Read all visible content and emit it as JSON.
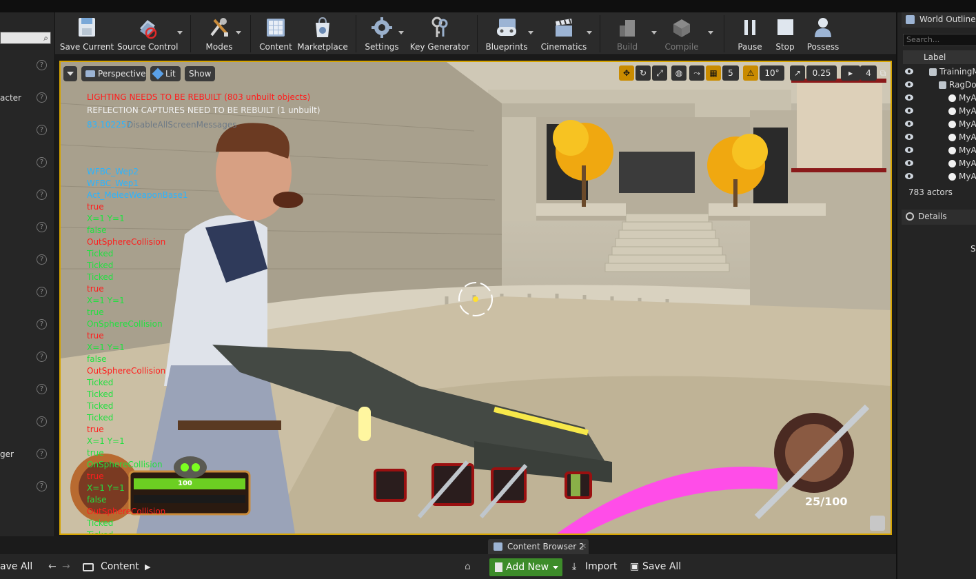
{
  "toolbar": {
    "buttons": [
      {
        "label": "Save Current",
        "icon": "save-icon"
      },
      {
        "label": "Source Control",
        "icon": "source-control-icon"
      },
      {
        "label": "Modes",
        "icon": "modes-icon"
      },
      {
        "label": "Content",
        "icon": "content-icon"
      },
      {
        "label": "Marketplace",
        "icon": "marketplace-icon"
      },
      {
        "label": "Settings",
        "icon": "settings-icon"
      },
      {
        "label": "Key Generator",
        "icon": "key-icon"
      },
      {
        "label": "Blueprints",
        "icon": "blueprints-icon"
      },
      {
        "label": "Cinematics",
        "icon": "clapper-icon"
      },
      {
        "label": "Build",
        "icon": "build-icon"
      },
      {
        "label": "Compile",
        "icon": "compile-icon"
      },
      {
        "label": "Pause",
        "icon": "pause-icon"
      },
      {
        "label": "Stop",
        "icon": "stop-icon"
      },
      {
        "label": "Possess",
        "icon": "possess-icon"
      }
    ]
  },
  "left_panel": {
    "items": [
      "",
      "acter",
      "",
      "",
      "",
      "",
      "",
      "",
      "",
      "",
      "",
      "",
      "ger",
      ""
    ]
  },
  "viewport": {
    "view_button": "Perspective",
    "lit_button": "Lit",
    "show_button": "Show",
    "grid_snap": "5",
    "angle_snap": "10°",
    "scale_snap": "0.25",
    "camera_speed": "4",
    "messages": [
      {
        "text": "LIGHTING NEEDS TO BE REBUILT (803 unbuilt objects)",
        "color": "red"
      },
      {
        "text": "REFLECTION CAPTURES NEED TO BE REBUILT (1 unbuilt)",
        "color": "white"
      },
      {
        "text": "83.102257",
        "color": "cyan"
      },
      {
        "text": "DisableAllScreenMessages",
        "color": "ghost"
      }
    ],
    "debug_lines": [
      {
        "text": "WFBC_Wep2",
        "color": "cyan"
      },
      {
        "text": "WFBC_Wep1",
        "color": "cyan"
      },
      {
        "text": "Act_MeleeWeaponBase1",
        "color": "cyan"
      },
      {
        "text": "true",
        "color": "red"
      },
      {
        "text": "X=1 Y=1",
        "color": "green"
      },
      {
        "text": "false",
        "color": "green"
      },
      {
        "text": "OutSphereCollision",
        "color": "red"
      },
      {
        "text": "Ticked",
        "color": "green"
      },
      {
        "text": "Ticked",
        "color": "green"
      },
      {
        "text": "Ticked",
        "color": "green"
      },
      {
        "text": "true",
        "color": "red"
      },
      {
        "text": "X=1 Y=1",
        "color": "green"
      },
      {
        "text": "true",
        "color": "green"
      },
      {
        "text": "OnSphereCollision",
        "color": "green"
      },
      {
        "text": "true",
        "color": "red"
      },
      {
        "text": "X=1 Y=1",
        "color": "green"
      },
      {
        "text": "false",
        "color": "green"
      },
      {
        "text": "OutSphereCollision",
        "color": "red"
      },
      {
        "text": "Ticked",
        "color": "green"
      },
      {
        "text": "Ticked",
        "color": "green"
      },
      {
        "text": "Ticked",
        "color": "green"
      },
      {
        "text": "Ticked",
        "color": "green"
      },
      {
        "text": "true",
        "color": "red"
      },
      {
        "text": "X=1 Y=1",
        "color": "green"
      },
      {
        "text": "true",
        "color": "green"
      },
      {
        "text": "OnSphereCollision",
        "color": "green"
      },
      {
        "text": "true",
        "color": "red"
      },
      {
        "text": "X=1 Y=1",
        "color": "green"
      },
      {
        "text": "false",
        "color": "green"
      },
      {
        "text": "OutSphereCollision",
        "color": "red"
      },
      {
        "text": "Ticked",
        "color": "green"
      },
      {
        "text": "Ticked",
        "color": "green"
      }
    ],
    "hud": {
      "health_value": "100",
      "health_fraction": 1.0,
      "ammo": "25/100"
    }
  },
  "world_outliner": {
    "title": "World Outliner",
    "search_placeholder": "Search...",
    "column_label": "Label",
    "rows": [
      {
        "text": "TrainingM",
        "indent": 1
      },
      {
        "text": "RagDol",
        "indent": 2
      },
      {
        "text": "MyAc",
        "indent": 3
      },
      {
        "text": "MyAc",
        "indent": 3
      },
      {
        "text": "MyAc",
        "indent": 3
      },
      {
        "text": "MyAc",
        "indent": 3
      },
      {
        "text": "MyAc",
        "indent": 3
      },
      {
        "text": "MyAc",
        "indent": 3
      },
      {
        "text": "MyAc",
        "indent": 3
      }
    ],
    "actor_count": "783 actors"
  },
  "details": {
    "title": "Details",
    "partial": "S"
  },
  "bottom": {
    "save_all_left": "ave All",
    "content_path": "Content",
    "tab_label": "Content Browser 2",
    "add_new": "Add New",
    "import": "Import",
    "save_all": "Save All"
  },
  "colors": {
    "viewport_border": "#d6a400",
    "red": "#ff1c1c",
    "green": "#22e040",
    "cyan": "#2bb4ff",
    "add_new": "#3d8c2a"
  }
}
